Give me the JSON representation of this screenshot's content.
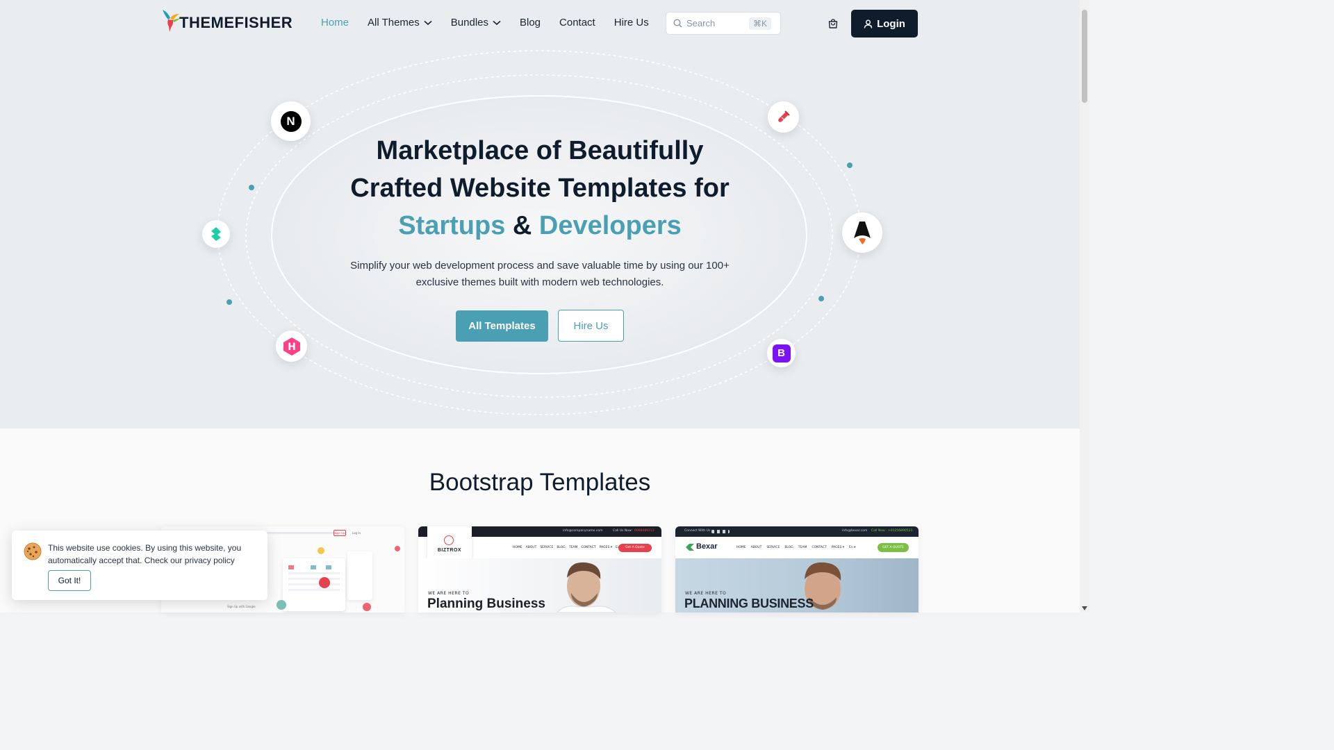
{
  "header": {
    "logo_text": "THEMEFISHER",
    "nav": [
      {
        "label": "Home",
        "active": true
      },
      {
        "label": "All Themes",
        "dropdown": true
      },
      {
        "label": "Bundles",
        "dropdown": true
      },
      {
        "label": "Blog"
      },
      {
        "label": "Contact"
      },
      {
        "label": "Hire Us"
      }
    ],
    "search_placeholder": "Search",
    "search_shortcut": "⌘K",
    "login_label": "Login"
  },
  "hero": {
    "title_line1": "Marketplace of Beautifully",
    "title_line2": "Crafted Website Templates for",
    "title_hl1": "Startups",
    "title_amp": "&",
    "title_hl2": "Developers",
    "subtitle": "Simplify your web development process and save valuable time by using our 100+ exclusive themes built with modern web technologies.",
    "primary_button": "All Templates",
    "secondary_button": "Hire Us",
    "tech_icons": [
      "nextjs-icon",
      "tailwind-test-tube-icon",
      "bolt-cms-icon",
      "astro-icon",
      "hugo-icon",
      "bootstrap-icon"
    ],
    "tech_labels": {
      "next": "N",
      "hugo": "H",
      "bootstrap": "B"
    }
  },
  "section": {
    "title": "Bootstrap Templates",
    "cards": [
      {
        "name": "dashboard-template",
        "btn1": "Sign Up",
        "btn2": "Log In",
        "label": "Sign Up with Google"
      },
      {
        "name": "Biztrox",
        "logo": "BIZTROX",
        "topbar_email": "info@companyname.com",
        "topbar_call": "Call Us Now:",
        "topbar_phone": "0088489213",
        "menu": [
          "HOME",
          "ABOUT",
          "SERVICE",
          "BLOG",
          "TEAM",
          "CONTACT",
          "PAGES ▾",
          "En ▾"
        ],
        "cta": "Get A Quote",
        "kicker": "WE ARE HERE TO",
        "headline": "Planning Business"
      },
      {
        "name": "Bexar",
        "logo": "Bexar",
        "topbar_connect": "Connect With Us :",
        "topbar_email": "info@bexar.com",
        "topbar_call": "Call Now : +01256890523",
        "menu": [
          "HOME",
          "ABOUT",
          "SERVICE",
          "BLOG",
          "TEAM",
          "CONTACT",
          "PAGES ▾",
          "En ▾"
        ],
        "cta": "GET A QUOTE",
        "kicker": "WE ARE HERE TO",
        "headline": "PLANNING BUSINESS"
      }
    ]
  },
  "cookie": {
    "text": "This website use cookies. By using this website, you automatically accept that. Check our privacy policy",
    "button": "Got It!"
  },
  "colors": {
    "accent": "#4b9fb2",
    "dark": "#0f1c2c",
    "hero_bg": "#eaedf0"
  }
}
